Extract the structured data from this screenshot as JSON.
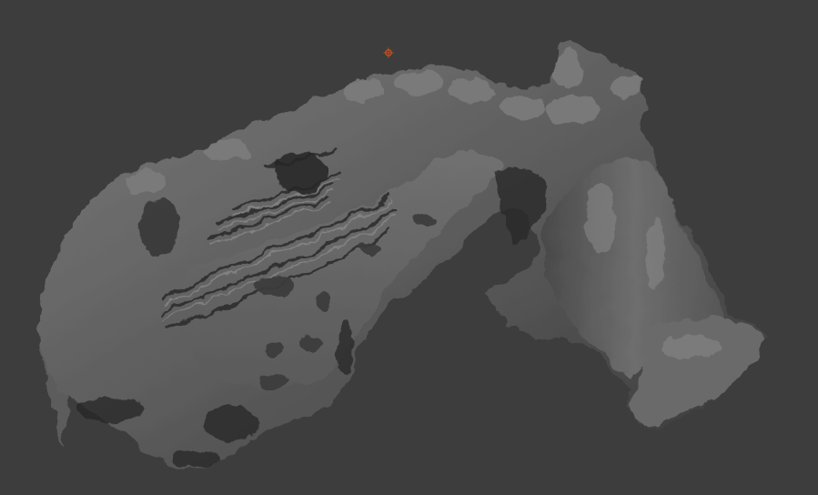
{
  "viewport": {
    "background_color": "#3d3d3d",
    "object_base_color": "#6a6a6a",
    "object_shadow_color": "#1f1f1f",
    "object_highlight_color": "#9a9a9a",
    "origin_marker_color": "#c0501e",
    "origin_marker_icon": "object-origin-icon"
  },
  "scene": {
    "object_type": "sculpted-terrain-mesh",
    "shading": "solid"
  }
}
